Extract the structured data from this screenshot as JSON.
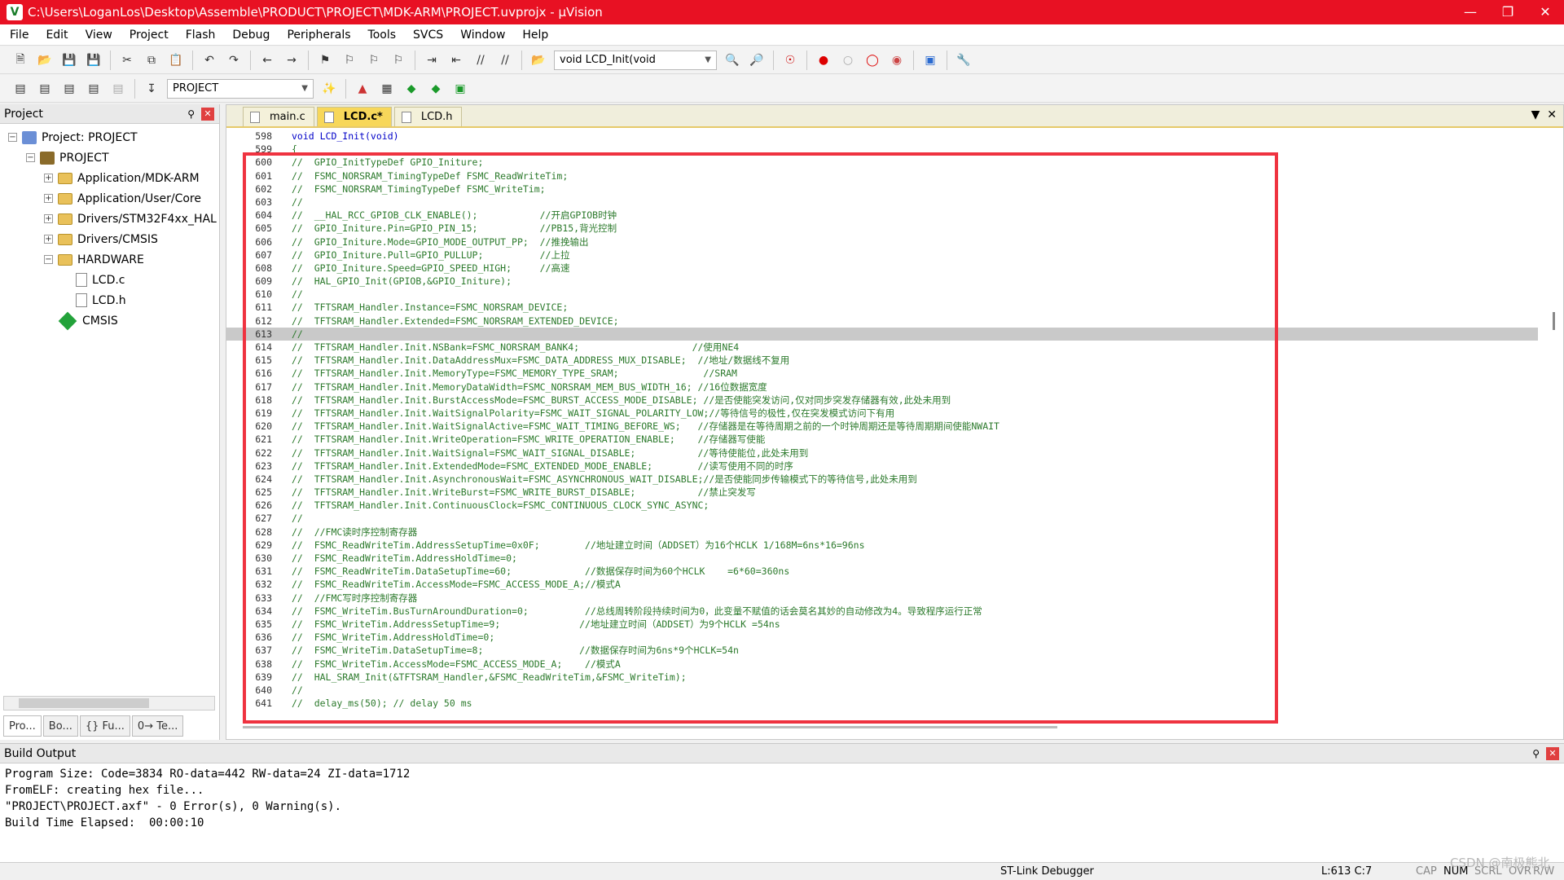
{
  "window": {
    "title": "C:\\Users\\LoganLos\\Desktop\\Assemble\\PRODUCT\\PROJECT\\MDK-ARM\\PROJECT.uvprojx - µVision"
  },
  "menu": [
    "File",
    "Edit",
    "View",
    "Project",
    "Flash",
    "Debug",
    "Peripherals",
    "Tools",
    "SVCS",
    "Window",
    "Help"
  ],
  "toolbar": {
    "function_combo": "void LCD_Init(void",
    "target_combo": "PROJECT"
  },
  "project_panel": {
    "title": "Project",
    "tree": [
      {
        "label": "Project: PROJECT",
        "depth": 0,
        "kind": "project",
        "expander": "−"
      },
      {
        "label": "PROJECT",
        "depth": 1,
        "kind": "target",
        "expander": "−"
      },
      {
        "label": "Application/MDK-ARM",
        "depth": 2,
        "kind": "folder",
        "expander": "+"
      },
      {
        "label": "Application/User/Core",
        "depth": 2,
        "kind": "folder",
        "expander": "+"
      },
      {
        "label": "Drivers/STM32F4xx_HAL",
        "depth": 2,
        "kind": "folder",
        "expander": "+"
      },
      {
        "label": "Drivers/CMSIS",
        "depth": 2,
        "kind": "folder",
        "expander": "+"
      },
      {
        "label": "HARDWARE",
        "depth": 2,
        "kind": "folder",
        "expander": "−"
      },
      {
        "label": "LCD.c",
        "depth": 3,
        "kind": "file",
        "expander": ""
      },
      {
        "label": "LCD.h",
        "depth": 3,
        "kind": "file",
        "expander": ""
      },
      {
        "label": "CMSIS",
        "depth": 2,
        "kind": "cmsis",
        "expander": ""
      }
    ],
    "tabs": [
      "Pro...",
      "Bo...",
      "{} Fu...",
      "0→ Te..."
    ]
  },
  "editor": {
    "tabs": [
      {
        "label": "main.c",
        "active": false
      },
      {
        "label": "LCD.c*",
        "active": true
      },
      {
        "label": "LCD.h",
        "active": false
      }
    ],
    "lines": [
      {
        "n": "598",
        "text": "void LCD_Init(void)"
      },
      {
        "n": "599",
        "text": "{"
      },
      {
        "n": "600",
        "text": "//  GPIO_InitTypeDef GPIO_Initure;"
      },
      {
        "n": "601",
        "text": "//  FSMC_NORSRAM_TimingTypeDef FSMC_ReadWriteTim;"
      },
      {
        "n": "602",
        "text": "//  FSMC_NORSRAM_TimingTypeDef FSMC_WriteTim;"
      },
      {
        "n": "603",
        "text": "//"
      },
      {
        "n": "604",
        "text": "//  __HAL_RCC_GPIOB_CLK_ENABLE();           //开启GPIOB时钟"
      },
      {
        "n": "605",
        "text": "//  GPIO_Initure.Pin=GPIO_PIN_15;           //PB15,背光控制"
      },
      {
        "n": "606",
        "text": "//  GPIO_Initure.Mode=GPIO_MODE_OUTPUT_PP;  //推挽输出"
      },
      {
        "n": "607",
        "text": "//  GPIO_Initure.Pull=GPIO_PULLUP;          //上拉"
      },
      {
        "n": "608",
        "text": "//  GPIO_Initure.Speed=GPIO_SPEED_HIGH;     //高速"
      },
      {
        "n": "609",
        "text": "//  HAL_GPIO_Init(GPIOB,&GPIO_Initure);"
      },
      {
        "n": "610",
        "text": "//"
      },
      {
        "n": "611",
        "text": "//  TFTSRAM_Handler.Instance=FSMC_NORSRAM_DEVICE;"
      },
      {
        "n": "612",
        "text": "//  TFTSRAM_Handler.Extended=FSMC_NORSRAM_EXTENDED_DEVICE;"
      },
      {
        "n": "613",
        "text": "//"
      },
      {
        "n": "614",
        "text": "//  TFTSRAM_Handler.Init.NSBank=FSMC_NORSRAM_BANK4;                    //使用NE4"
      },
      {
        "n": "615",
        "text": "//  TFTSRAM_Handler.Init.DataAddressMux=FSMC_DATA_ADDRESS_MUX_DISABLE;  //地址/数据线不复用"
      },
      {
        "n": "616",
        "text": "//  TFTSRAM_Handler.Init.MemoryType=FSMC_MEMORY_TYPE_SRAM;               //SRAM"
      },
      {
        "n": "617",
        "text": "//  TFTSRAM_Handler.Init.MemoryDataWidth=FSMC_NORSRAM_MEM_BUS_WIDTH_16; //16位数据宽度"
      },
      {
        "n": "618",
        "text": "//  TFTSRAM_Handler.Init.BurstAccessMode=FSMC_BURST_ACCESS_MODE_DISABLE; //是否使能突发访问,仅对同步突发存储器有效,此处未用到"
      },
      {
        "n": "619",
        "text": "//  TFTSRAM_Handler.Init.WaitSignalPolarity=FSMC_WAIT_SIGNAL_POLARITY_LOW;//等待信号的极性,仅在突发模式访问下有用"
      },
      {
        "n": "620",
        "text": "//  TFTSRAM_Handler.Init.WaitSignalActive=FSMC_WAIT_TIMING_BEFORE_WS;   //存储器是在等待周期之前的一个时钟周期还是等待周期期间使能NWAIT"
      },
      {
        "n": "621",
        "text": "//  TFTSRAM_Handler.Init.WriteOperation=FSMC_WRITE_OPERATION_ENABLE;    //存储器写使能"
      },
      {
        "n": "622",
        "text": "//  TFTSRAM_Handler.Init.WaitSignal=FSMC_WAIT_SIGNAL_DISABLE;           //等待使能位,此处未用到"
      },
      {
        "n": "623",
        "text": "//  TFTSRAM_Handler.Init.ExtendedMode=FSMC_EXTENDED_MODE_ENABLE;        //读写使用不同的时序"
      },
      {
        "n": "624",
        "text": "//  TFTSRAM_Handler.Init.AsynchronousWait=FSMC_ASYNCHRONOUS_WAIT_DISABLE;//是否使能同步传输模式下的等待信号,此处未用到"
      },
      {
        "n": "625",
        "text": "//  TFTSRAM_Handler.Init.WriteBurst=FSMC_WRITE_BURST_DISABLE;           //禁止突发写"
      },
      {
        "n": "626",
        "text": "//  TFTSRAM_Handler.Init.ContinuousClock=FSMC_CONTINUOUS_CLOCK_SYNC_ASYNC;"
      },
      {
        "n": "627",
        "text": "//"
      },
      {
        "n": "628",
        "text": "//  //FMC读时序控制寄存器"
      },
      {
        "n": "629",
        "text": "//  FSMC_ReadWriteTim.AddressSetupTime=0x0F;        //地址建立时间（ADDSET）为16个HCLK 1/168M=6ns*16=96ns"
      },
      {
        "n": "630",
        "text": "//  FSMC_ReadWriteTim.AddressHoldTime=0;"
      },
      {
        "n": "631",
        "text": "//  FSMC_ReadWriteTim.DataSetupTime=60;             //数据保存时间为60个HCLK    =6*60=360ns"
      },
      {
        "n": "632",
        "text": "//  FSMC_ReadWriteTim.AccessMode=FSMC_ACCESS_MODE_A;//模式A"
      },
      {
        "n": "633",
        "text": "//  //FMC写时序控制寄存器"
      },
      {
        "n": "634",
        "text": "//  FSMC_WriteTim.BusTurnAroundDuration=0;          //总线周转阶段持续时间为0，此变量不赋值的话会莫名其妙的自动修改为4。导致程序运行正常"
      },
      {
        "n": "635",
        "text": "//  FSMC_WriteTim.AddressSetupTime=9;              //地址建立时间（ADDSET）为9个HCLK =54ns"
      },
      {
        "n": "636",
        "text": "//  FSMC_WriteTim.AddressHoldTime=0;"
      },
      {
        "n": "637",
        "text": "//  FSMC_WriteTim.DataSetupTime=8;                 //数据保存时间为6ns*9个HCLK=54n"
      },
      {
        "n": "638",
        "text": "//  FSMC_WriteTim.AccessMode=FSMC_ACCESS_MODE_A;    //模式A"
      },
      {
        "n": "639",
        "text": "//  HAL_SRAM_Init(&TFTSRAM_Handler,&FSMC_ReadWriteTim,&FSMC_WriteTim);"
      },
      {
        "n": "640",
        "text": "//"
      },
      {
        "n": "641",
        "text": "//  delay_ms(50); // delay 50 ms"
      }
    ],
    "highlighted_line": "613"
  },
  "build_output": {
    "title": "Build Output",
    "lines": [
      "Program Size: Code=3834 RO-data=442 RW-data=24 ZI-data=1712",
      "FromELF: creating hex file...",
      "\"PROJECT\\PROJECT.axf\" - 0 Error(s), 0 Warning(s).",
      "Build Time Elapsed:  00:00:10"
    ]
  },
  "status": {
    "debugger": "ST-Link Debugger",
    "cursor": "L:613 C:7",
    "cap": "CAP",
    "num": "NUM",
    "scrl": "SCRL",
    "ovr": "OVR",
    "rw": "R/W"
  },
  "watermark": "CSDN @南极熊北",
  "colors": {
    "titlebar": "#e81123",
    "highlight_box": "#ef3340",
    "comment": "#2c7a2c",
    "active_tab": "#f7d75a"
  }
}
